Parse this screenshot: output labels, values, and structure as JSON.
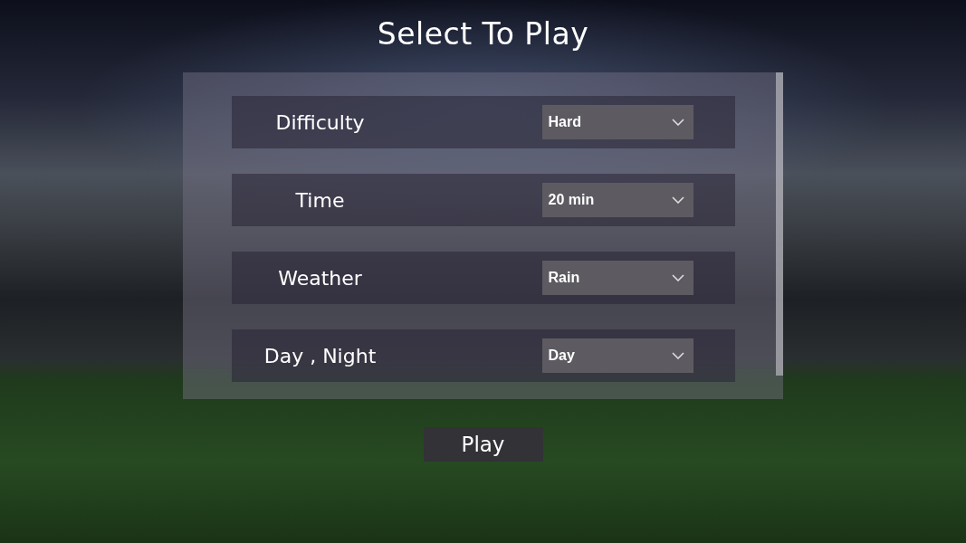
{
  "title": "Select To Play",
  "settings": [
    {
      "label": "Difficulty",
      "value": "Hard"
    },
    {
      "label": "Time",
      "value": "20 min"
    },
    {
      "label": "Weather",
      "value": "Rain"
    },
    {
      "label": "Day , Night",
      "value": "Day"
    }
  ],
  "play_button": {
    "label": "Play"
  }
}
